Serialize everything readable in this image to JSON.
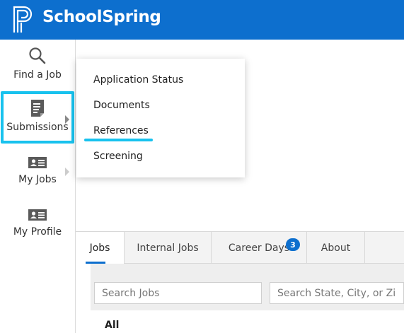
{
  "header": {
    "brand": "SchoolSpring",
    "bg_color": "#0d6fce"
  },
  "sidebar": {
    "items": [
      {
        "label": "Find a Job",
        "icon": "search-icon"
      },
      {
        "label": "Submissions",
        "icon": "document-icon"
      },
      {
        "label": "My Jobs",
        "icon": "id-card-icon"
      },
      {
        "label": "My Profile",
        "icon": "id-card-icon"
      }
    ],
    "highlight_color": "#18c2ee"
  },
  "dropdown": {
    "items": [
      "Application Status",
      "Documents",
      "References",
      "Screening"
    ]
  },
  "tabs": {
    "items": [
      "Jobs",
      "Internal Jobs",
      "Career Days",
      "About"
    ],
    "career_days_badge": "3"
  },
  "search": {
    "jobs_placeholder": "Search Jobs",
    "location_placeholder": "Search State, City, or Zip"
  },
  "results": {
    "filter_label": "All"
  }
}
